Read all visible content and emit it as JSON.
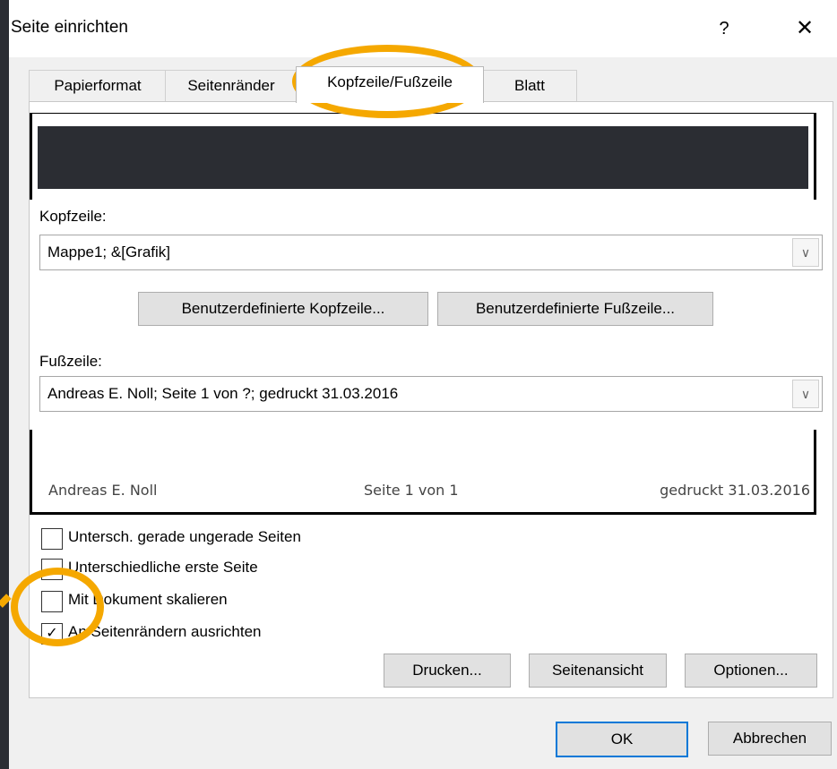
{
  "dialog": {
    "title": "Seite einrichten",
    "help_label": "?",
    "close_label": "✕"
  },
  "tabs": [
    {
      "label": "Papierformat"
    },
    {
      "label": "Seitenränder"
    },
    {
      "label": "Kopfzeile/Fußzeile"
    },
    {
      "label": "Blatt"
    }
  ],
  "header": {
    "label": "Kopfzeile:",
    "value": "Mappe1; &[Grafik]"
  },
  "buttons": {
    "custom_header": "Benutzerdefinierte Kopfzeile...",
    "custom_footer": "Benutzerdefinierte Fußzeile..."
  },
  "footer": {
    "label": "Fußzeile:",
    "value": "Andreas E. Noll; Seite 1 von ?; gedruckt 31.03.2016"
  },
  "footer_preview": {
    "left": "Andreas E. Noll",
    "center": "Seite 1 von 1",
    "right": "gedruckt 31.03.2016"
  },
  "checkboxes": [
    {
      "label": "Untersch. gerade ungerade Seiten",
      "checked": false
    },
    {
      "label": "Unterschiedliche erste Seite",
      "checked": false
    },
    {
      "label": "Mit Dokument skalieren",
      "checked": false
    },
    {
      "label": "An Seitenrändern ausrichten",
      "checked": true
    }
  ],
  "actions": {
    "print": "Drucken...",
    "preview": "Seitenansicht",
    "options": "Optionen...",
    "ok": "OK",
    "cancel": "Abbrechen"
  },
  "colors": {
    "highlight": "#f5a800",
    "accent": "#0078d7"
  }
}
